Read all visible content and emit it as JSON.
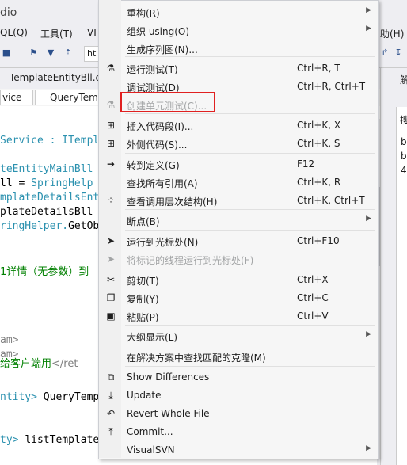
{
  "window": {
    "title_fragment": "dio"
  },
  "menubar": {
    "items": [
      "QL(Q)",
      "工具(T)",
      "VI",
      "助(H)"
    ]
  },
  "toolbar": {
    "input_fragment": "ht"
  },
  "tabs": {
    "doc_tab": "TemplateEntityBll.c"
  },
  "navbar": {
    "left_box": "vice",
    "right_box": "QueryTem"
  },
  "right_panel": {
    "tab_label": "解",
    "search_fragment": "搜",
    "lines": [
      "b",
      "b",
      "4"
    ]
  },
  "editor": {
    "lines": [
      {
        "a": "Service : ",
        "b": "ITempl"
      },
      {
        "a": "teEntityMainBll",
        "b": ""
      },
      {
        "a": "ll = ",
        "b": "SpringHelp"
      },
      {
        "a": "mplateDetailsEnt",
        "b": ""
      },
      {
        "a": "plateDetailsBll",
        "b": ""
      },
      {
        "a": "ringHelper.",
        "b": "GetOb"
      },
      {
        "a": "1详情（无参数）到",
        "b": ""
      },
      {
        "a": "am>",
        "b": ""
      },
      {
        "a": "am>",
        "b": ""
      },
      {
        "a": "给客户端用",
        "b": "</ret"
      },
      {
        "a": "ntity> ",
        "b": "QueryTemp"
      },
      {
        "a": "ty> ",
        "b": "listTemplate"
      }
    ]
  },
  "context_menu": {
    "items": [
      {
        "label": "重构(R)",
        "shortcut": "",
        "submenu": true,
        "icon": "",
        "disabled": false
      },
      {
        "label": "组织 using(O)",
        "shortcut": "",
        "submenu": true,
        "icon": "",
        "disabled": false
      },
      {
        "label": "生成序列图(N)...",
        "shortcut": "",
        "submenu": false,
        "icon": "",
        "disabled": false
      },
      {
        "label": "运行测试(T)",
        "shortcut": "Ctrl+R, T",
        "submenu": false,
        "icon": "run-tests-icon",
        "disabled": false
      },
      {
        "label": "调试测试(D)",
        "shortcut": "Ctrl+R, Ctrl+T",
        "submenu": false,
        "icon": "",
        "disabled": false
      },
      {
        "label": "创建单元测试(C)...",
        "shortcut": "",
        "submenu": false,
        "icon": "create-unit-test-icon",
        "disabled": true
      },
      {
        "label": "插入代码段(I)...",
        "shortcut": "Ctrl+K, X",
        "submenu": false,
        "icon": "insert-snippet-icon",
        "disabled": false
      },
      {
        "label": "外侧代码(S)...",
        "shortcut": "Ctrl+K, S",
        "submenu": false,
        "icon": "surround-with-icon",
        "disabled": false
      },
      {
        "label": "转到定义(G)",
        "shortcut": "F12",
        "submenu": false,
        "icon": "go-to-definition-icon",
        "disabled": false
      },
      {
        "label": "查找所有引用(A)",
        "shortcut": "Ctrl+K, R",
        "submenu": false,
        "icon": "",
        "disabled": false
      },
      {
        "label": "查看调用层次结构(H)",
        "shortcut": "Ctrl+K, Ctrl+T",
        "submenu": false,
        "icon": "call-hierarchy-icon",
        "disabled": false
      },
      {
        "label": "断点(B)",
        "shortcut": "",
        "submenu": true,
        "icon": "",
        "disabled": false
      },
      {
        "label": "运行到光标处(N)",
        "shortcut": "Ctrl+F10",
        "submenu": false,
        "icon": "run-to-cursor-icon",
        "disabled": false
      },
      {
        "label": "将标记的线程运行到光标处(F)",
        "shortcut": "",
        "submenu": false,
        "icon": "run-flagged-threads-icon",
        "disabled": true
      },
      {
        "label": "剪切(T)",
        "shortcut": "Ctrl+X",
        "submenu": false,
        "icon": "scissors-icon",
        "disabled": false
      },
      {
        "label": "复制(Y)",
        "shortcut": "Ctrl+C",
        "submenu": false,
        "icon": "copy-icon",
        "disabled": false
      },
      {
        "label": "粘贴(P)",
        "shortcut": "Ctrl+V",
        "submenu": false,
        "icon": "paste-icon",
        "disabled": false
      },
      {
        "label": "大纲显示(L)",
        "shortcut": "",
        "submenu": true,
        "icon": "",
        "disabled": false
      },
      {
        "label": "在解决方案中查找匹配的克隆(M)",
        "shortcut": "",
        "submenu": false,
        "icon": "",
        "disabled": false
      },
      {
        "label": "Show Differences",
        "shortcut": "",
        "submenu": false,
        "icon": "show-differences-icon",
        "disabled": false
      },
      {
        "label": "Update",
        "shortcut": "",
        "submenu": false,
        "icon": "update-icon",
        "disabled": false
      },
      {
        "label": "Revert Whole File",
        "shortcut": "",
        "submenu": false,
        "icon": "revert-icon",
        "disabled": false
      },
      {
        "label": "Commit...",
        "shortcut": "",
        "submenu": false,
        "icon": "commit-icon",
        "disabled": false
      },
      {
        "label": "VisualSVN",
        "shortcut": "",
        "submenu": true,
        "icon": "",
        "disabled": false
      }
    ]
  },
  "colors": {
    "highlight_border": "#e02020",
    "type_color": "#2b91af",
    "comment_color": "#008000"
  }
}
